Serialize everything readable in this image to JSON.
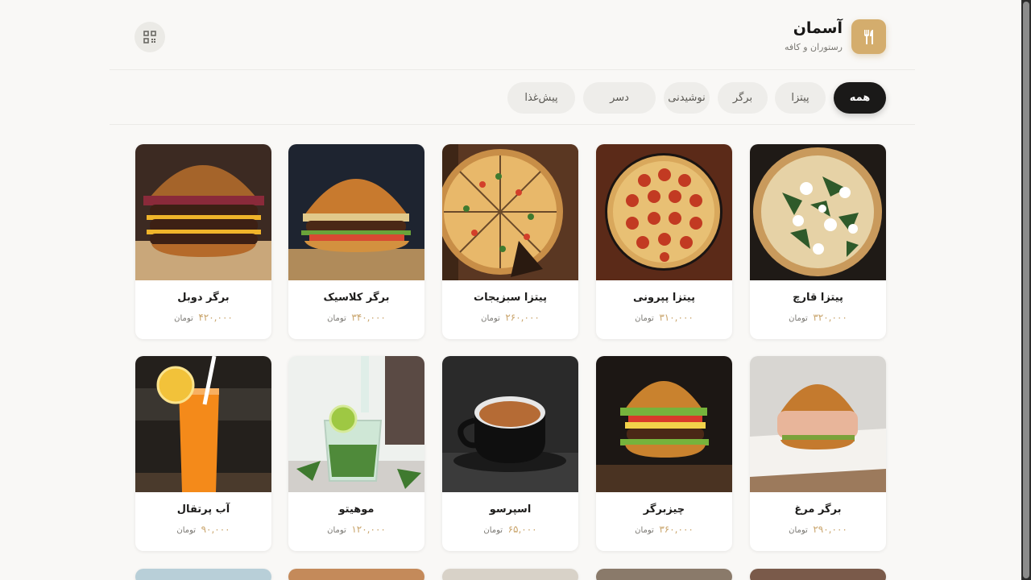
{
  "brand": {
    "title": "آسمان",
    "subtitle": "رستوران و کافه",
    "logo_icon": "fork-knife-icon",
    "accent": "#d4ad6d"
  },
  "header": {
    "qr_icon": "qr-code-icon"
  },
  "tabs": [
    {
      "label": "همه",
      "active": true
    },
    {
      "label": "پیتزا",
      "active": false
    },
    {
      "label": "برگر",
      "active": false
    },
    {
      "label": "نوشیدنی",
      "active": false
    },
    {
      "label": "دسر",
      "active": false
    },
    {
      "label": "پیش‌غذا",
      "active": false
    }
  ],
  "currency": "تومان",
  "items": [
    {
      "name": "پیتزا قارچ",
      "price": "۳۲۰,۰۰۰",
      "image": "mushroom-pizza"
    },
    {
      "name": "پیتزا پپرونی",
      "price": "۳۱۰,۰۰۰",
      "image": "pepperoni-pizza"
    },
    {
      "name": "پیتزا سبزیجات",
      "price": "۲۶۰,۰۰۰",
      "image": "veggie-pizza"
    },
    {
      "name": "برگر کلاسیک",
      "price": "۳۴۰,۰۰۰",
      "image": "classic-burger"
    },
    {
      "name": "برگر دوبل",
      "price": "۴۲۰,۰۰۰",
      "image": "double-burger"
    },
    {
      "name": "برگر مرغ",
      "price": "۲۹۰,۰۰۰",
      "image": "chicken-burger"
    },
    {
      "name": "چیزبرگر",
      "price": "۳۶۰,۰۰۰",
      "image": "cheeseburger"
    },
    {
      "name": "اسپرسو",
      "price": "۶۵,۰۰۰",
      "image": "espresso"
    },
    {
      "name": "موهیتو",
      "price": "۱۲۰,۰۰۰",
      "image": "mojito"
    },
    {
      "name": "آب پرتقال",
      "price": "۹۰,۰۰۰",
      "image": "orange-juice"
    }
  ]
}
